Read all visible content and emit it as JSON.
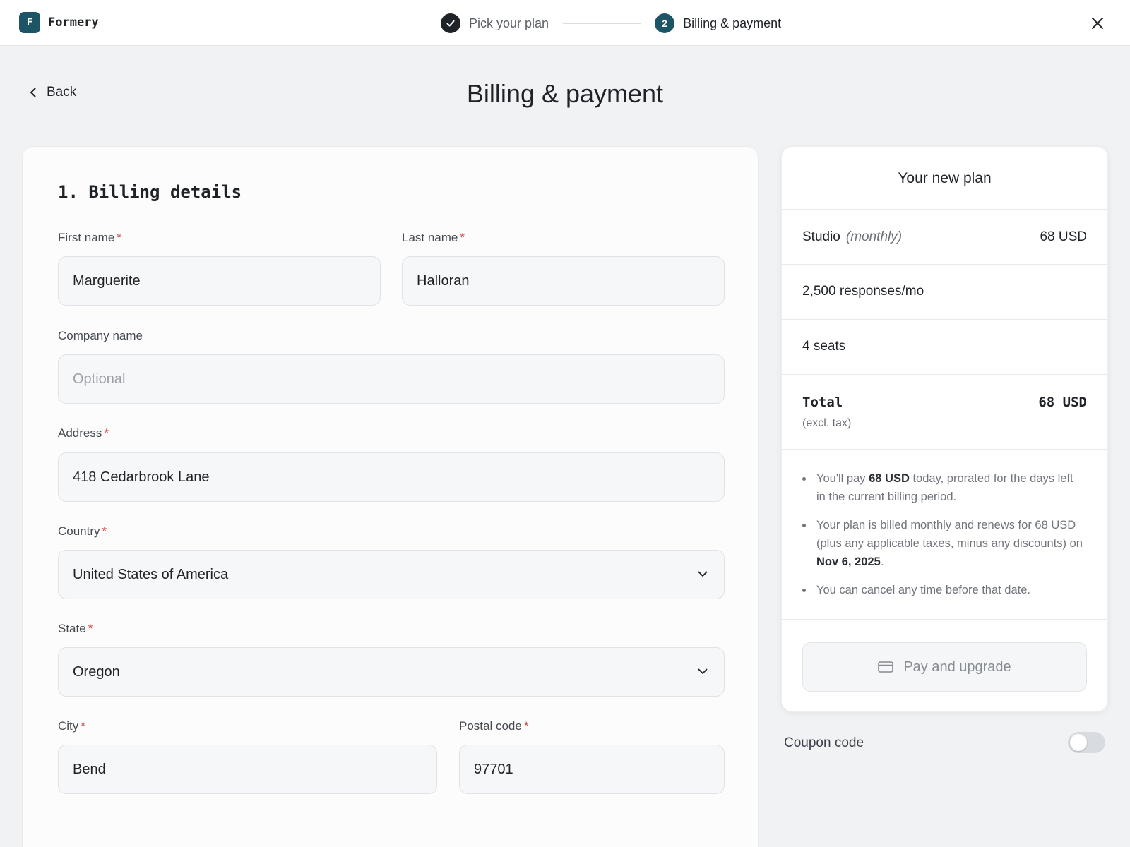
{
  "brand": {
    "logo_letter": "F",
    "name": "Formery",
    "logo_color": "#1d5566"
  },
  "stepper": {
    "steps": [
      {
        "label": "Pick your plan",
        "status": "complete",
        "icon": "check-icon"
      },
      {
        "number": "2",
        "label": "Billing & payment",
        "status": "current"
      }
    ]
  },
  "close": {
    "icon": "close-icon"
  },
  "header": {
    "back_label": "Back",
    "title": "Billing & payment"
  },
  "billing": {
    "section_title": "1. Billing details",
    "required_marker": "*",
    "first_name": {
      "label": "First name",
      "value": "Marguerite"
    },
    "last_name": {
      "label": "Last name",
      "value": "Halloran"
    },
    "company": {
      "label": "Company name",
      "value": "",
      "placeholder": "Optional"
    },
    "address": {
      "label": "Address",
      "value": "418 Cedarbrook Lane"
    },
    "country": {
      "label": "Country",
      "value": "United States of America"
    },
    "state": {
      "label": "State",
      "value": "Oregon"
    },
    "city": {
      "label": "City",
      "value": "Bend"
    },
    "postal": {
      "label": "Postal code",
      "value": "97701"
    }
  },
  "plan": {
    "title": "Your new plan",
    "name": "Studio",
    "period": "(monthly)",
    "price": "68 USD",
    "responses": "2,500 responses/mo",
    "seats": "4 seats",
    "total_label": "Total",
    "total_value": "68 USD",
    "tax_note": "(excl. tax)",
    "notes": {
      "n1_pre": "You'll pay ",
      "n1_bold": "68 USD",
      "n1_post": " today, prorated for the days left in the current billing period.",
      "n2_pre": "Your plan is billed monthly and renews for 68 USD (plus any applicable taxes, minus any discounts) on ",
      "n2_bold": "Nov 6, 2025",
      "n2_post": ".",
      "n3": "You can cancel any time before that date."
    },
    "pay_button": "Pay and upgrade",
    "pay_icon": "credit-card-icon"
  },
  "coupon": {
    "label": "Coupon code",
    "enabled": false
  }
}
